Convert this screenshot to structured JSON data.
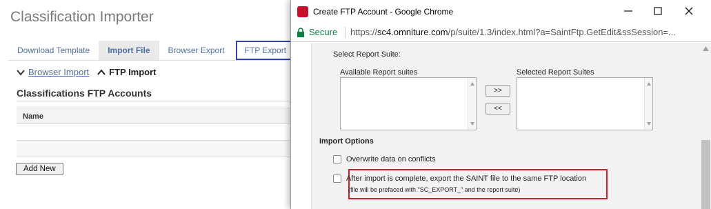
{
  "background": {
    "title": "Classification Importer",
    "tabs": [
      {
        "label": "Download Template"
      },
      {
        "label": "Import File"
      },
      {
        "label": "Browser Export"
      },
      {
        "label": "FTP Export"
      }
    ],
    "subnav": {
      "link": "Browser Import",
      "current": "FTP Import"
    },
    "section_title": "Classifications FTP Accounts",
    "table": {
      "header": "Name"
    },
    "add_button": "Add New"
  },
  "popup": {
    "window_title": "Create FTP Account - Google Chrome",
    "secure_label": "Secure",
    "url_scheme": "https://",
    "url_host": "sc4.omniture.com",
    "url_rest": "/p/suite/1.3/index.html?a=SaintFtp.GetEdit&ssSession=...",
    "select_suite_label": "Select Report Suite:",
    "available_label": "Available Report suites",
    "selected_label": "Selected Report Suites",
    "move_right": ">>",
    "move_left": "<<",
    "import_options_label": "Import Options",
    "overwrite_label": "Overwrite data on conflicts",
    "export_label": "After import is complete, export the SAINT file to the same FTP location",
    "export_note": "(file will be prefaced with \"SC_EXPORT_\" and the report suite)"
  },
  "colors": {
    "link": "#4f6fa8",
    "highlight_tab_border": "#3340b0",
    "callout_border": "#d0202e",
    "secure_green": "#0b8043"
  }
}
